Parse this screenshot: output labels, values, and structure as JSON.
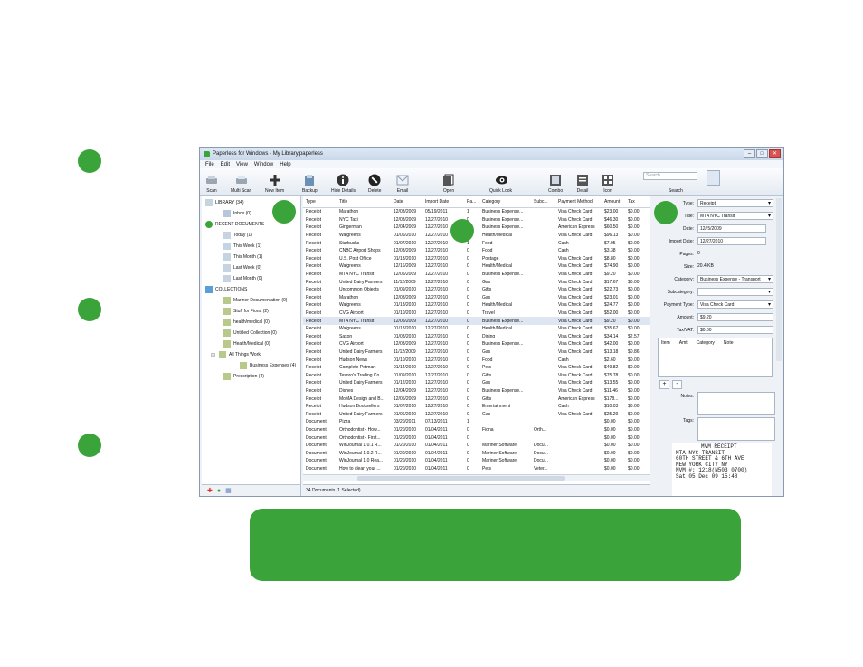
{
  "window": {
    "title": "Paperless for Windows - My Library.paperless",
    "controls": [
      "–",
      "□",
      "✕"
    ]
  },
  "menu": [
    "File",
    "Edit",
    "View",
    "Window",
    "Help"
  ],
  "toolbar": {
    "buttons": [
      "Scan",
      "Multi Scan",
      "New Item",
      "Backup",
      "Hide Details",
      "Delete",
      "Email",
      "Open",
      "Quick Look",
      "Combo",
      "Detail",
      "Icon",
      "Search"
    ],
    "search_placeholder": "Search"
  },
  "sidebar": {
    "library": "LIBRARY (34)",
    "inbox": "Inbox (0)",
    "recent": "RECENT DOCUMENTS",
    "recent_items": [
      "Today (1)",
      "This Week (1)",
      "This Month (1)",
      "Last Week (0)",
      "Last Month (0)"
    ],
    "collections": "COLLECTIONS",
    "collection_items": [
      "Mariner Documentation (0)",
      "Stuff for Fiona (2)",
      "health/medical (0)",
      "Untitled Collection (0)",
      "Health/Medical (0)",
      "All Things Work",
      "Business Expenses (4)",
      "Prescription (4)"
    ],
    "footer_icons": [
      "✚",
      "●",
      "▦"
    ]
  },
  "table": {
    "columns": [
      "Type",
      "Title",
      "Date",
      "Import Date",
      "Pa...",
      "Category",
      "Subc...",
      "Payment Method",
      "Amount",
      "Tax"
    ],
    "rows": [
      [
        "Receipt",
        "Marathon",
        "12/03/2009",
        "05/19/2011",
        "1",
        "Business Expense...",
        "",
        "Visa Check Card",
        "$23.00",
        "$0.00"
      ],
      [
        "Receipt",
        "NYC Taxi",
        "12/03/2009",
        "12/27/2010",
        "0",
        "Business Expense...",
        "",
        "Visa Check Card",
        "$46.30",
        "$0.00"
      ],
      [
        "Receipt",
        "Gingerman",
        "12/04/2009",
        "12/27/2010",
        "0",
        "Business Expense...",
        "",
        "American Express",
        "$60.50",
        "$0.00"
      ],
      [
        "Receipt",
        "Walgreens",
        "01/06/2010",
        "12/27/2010",
        "0",
        "Health/Medical",
        "",
        "Visa Check Card",
        "$96.13",
        "$0.00"
      ],
      [
        "Receipt",
        "Starbucks",
        "01/07/2010",
        "12/27/2010",
        "1",
        "Food",
        "",
        "Cash",
        "$7.95",
        "$0.00"
      ],
      [
        "Receipt",
        "CNBC Airport Shops",
        "12/03/2009",
        "12/27/2010",
        "0",
        "Food",
        "",
        "Cash",
        "$3.38",
        "$0.00"
      ],
      [
        "Receipt",
        "U.S. Post Office",
        "01/13/2010",
        "12/27/2010",
        "0",
        "Postage",
        "",
        "Visa Check Card",
        "$8.80",
        "$0.00"
      ],
      [
        "Receipt",
        "Walgreens",
        "12/16/2009",
        "12/27/2010",
        "0",
        "Health/Medical",
        "",
        "Visa Check Card",
        "$74.90",
        "$0.00"
      ],
      [
        "Receipt",
        "MTA NYC Transit",
        "12/05/2009",
        "12/27/2010",
        "0",
        "Business Expense...",
        "",
        "Visa Check Card",
        "$9.20",
        "$0.00"
      ],
      [
        "Receipt",
        "United Dairy Farmers",
        "11/12/2009",
        "12/27/2010",
        "0",
        "Gas",
        "",
        "Visa Check Card",
        "$17.67",
        "$0.00"
      ],
      [
        "Receipt",
        "Uncommon Objects",
        "01/09/2010",
        "12/27/2010",
        "0",
        "Gifts",
        "",
        "Visa Check Card",
        "$22.73",
        "$0.00"
      ],
      [
        "Receipt",
        "Marathon",
        "12/03/2009",
        "12/27/2010",
        "0",
        "Gas",
        "",
        "Visa Check Card",
        "$23.01",
        "$0.00"
      ],
      [
        "Receipt",
        "Walgreens",
        "01/18/2010",
        "12/27/2010",
        "0",
        "Health/Medical",
        "",
        "Visa Check Card",
        "$24.77",
        "$0.00"
      ],
      [
        "Receipt",
        "CVG Airport",
        "01/10/2010",
        "12/27/2010",
        "0",
        "Travel",
        "",
        "Visa Check Card",
        "$52.00",
        "$0.00"
      ],
      [
        "Receipt",
        "MTA NYC Transit",
        "12/05/2009",
        "12/27/2010",
        "0",
        "Business Expense...",
        "",
        "Visa Check Card",
        "$9.20",
        "$0.00"
      ],
      [
        "Receipt",
        "Walgreens",
        "01/18/2010",
        "12/27/2010",
        "0",
        "Health/Medical",
        "",
        "Visa Check Card",
        "$35.67",
        "$0.00"
      ],
      [
        "Receipt",
        "Saxon",
        "01/08/2010",
        "12/27/2010",
        "0",
        "Dining",
        "",
        "Visa Check Card",
        "$34.14",
        "$2.57"
      ],
      [
        "Receipt",
        "CVG Airport",
        "12/03/2009",
        "12/27/2010",
        "0",
        "Business Expense...",
        "",
        "Visa Check Card",
        "$42.00",
        "$0.00"
      ],
      [
        "Receipt",
        "United Dairy Farmers",
        "11/12/2009",
        "12/27/2010",
        "0",
        "Gas",
        "",
        "Visa Check Card",
        "$13.18",
        "$0.86"
      ],
      [
        "Receipt",
        "Hudson News",
        "01/10/2010",
        "12/27/2010",
        "0",
        "Food",
        "",
        "Cash",
        "$2.60",
        "$0.00"
      ],
      [
        "Receipt",
        "Complete Petmart",
        "01/14/2010",
        "12/27/2010",
        "0",
        "Pets",
        "",
        "Visa Check Card",
        "$49.82",
        "$0.00"
      ],
      [
        "Receipt",
        "Tesoro's Trading Co.",
        "01/09/2010",
        "12/27/2010",
        "0",
        "Gifts",
        "",
        "Visa Check Card",
        "$75.78",
        "$0.00"
      ],
      [
        "Receipt",
        "United Dairy Farmers",
        "01/12/2010",
        "12/27/2010",
        "0",
        "Gas",
        "",
        "Visa Check Card",
        "$13.55",
        "$0.00"
      ],
      [
        "Receipt",
        "Dishes",
        "12/04/2009",
        "12/27/2010",
        "0",
        "Business Expense...",
        "",
        "Visa Check Card",
        "$11.46",
        "$0.00"
      ],
      [
        "Receipt",
        "MoMA Design and B...",
        "12/05/2009",
        "12/27/2010",
        "0",
        "Gifts",
        "",
        "American Express",
        "$178...",
        "$0.00"
      ],
      [
        "Receipt",
        "Hudson Booksellers",
        "01/07/2010",
        "12/27/2010",
        "0",
        "Entertainment",
        "",
        "Cash",
        "$10.03",
        "$0.00"
      ],
      [
        "Receipt",
        "United Dairy Farmers",
        "01/06/2010",
        "12/27/2010",
        "0",
        "Gas",
        "",
        "Visa Check Card",
        "$25.29",
        "$0.00"
      ],
      [
        "Document",
        "Pizza",
        "03/20/2011",
        "07/13/2011",
        "1",
        "",
        "",
        "",
        "$0.00",
        "$0.00"
      ],
      [
        "Document",
        "Orthodontist - How...",
        "01/20/2010",
        "01/04/2011",
        "0",
        "Fiona",
        "Orth...",
        "",
        "$0.00",
        "$0.00"
      ],
      [
        "Document",
        "Orthodontist - First...",
        "01/20/2010",
        "01/04/2011",
        "0",
        "",
        "",
        "",
        "$0.00",
        "$0.00"
      ],
      [
        "Document",
        "WinJournal 1.0.1 R...",
        "01/20/2010",
        "01/04/2011",
        "0",
        "Mariner Software",
        "Docu...",
        "",
        "$0.00",
        "$0.00"
      ],
      [
        "Document",
        "WinJournal 1.0.2 R...",
        "01/20/2010",
        "01/04/2011",
        "0",
        "Mariner Software",
        "Docu...",
        "",
        "$0.00",
        "$0.00"
      ],
      [
        "Document",
        "WinJournal 1.0 Rea...",
        "01/20/2010",
        "01/04/2011",
        "0",
        "Mariner Software",
        "Docu...",
        "",
        "$0.00",
        "$0.00"
      ],
      [
        "Document",
        "How to clean your ...",
        "01/20/2010",
        "01/04/2011",
        "0",
        "Pets",
        "Veter...",
        "",
        "$0.00",
        "$0.00"
      ]
    ]
  },
  "status": "34 Documents (1 Selected)",
  "details": {
    "labels": [
      "Type:",
      "Title:",
      "Date:",
      "Import Date:",
      "Pages:",
      "Size:",
      "Category:",
      "Subcategory:",
      "Payment Type:",
      "Amount:",
      "Tax/VAT:"
    ],
    "type": "Receipt",
    "title": "MTA NYC Transit",
    "date": "12/ 5/2009",
    "import_date": "12/27/2010",
    "pages": "0",
    "size": "20.4 KB",
    "category": "Business Expense - Transport",
    "subcategory": "",
    "payment_type": "Visa Check Card",
    "amount": "$9.20",
    "tax": "$0.00",
    "grid_headers": [
      "Item",
      "Amt",
      "Category",
      "Note"
    ],
    "add": "+",
    "remove": "-",
    "notes_label": "Notes:",
    "tags_label": "Tags:",
    "receipt_lines": [
      "MVM RECEIPT",
      "MTA NYC TRANSIT",
      "60TH STREET & 6TH AVE",
      "NEW YORK CITY NY",
      "MVM #: 1218(N503 0700)",
      "Sat 05 Dec 09 15:48"
    ]
  }
}
